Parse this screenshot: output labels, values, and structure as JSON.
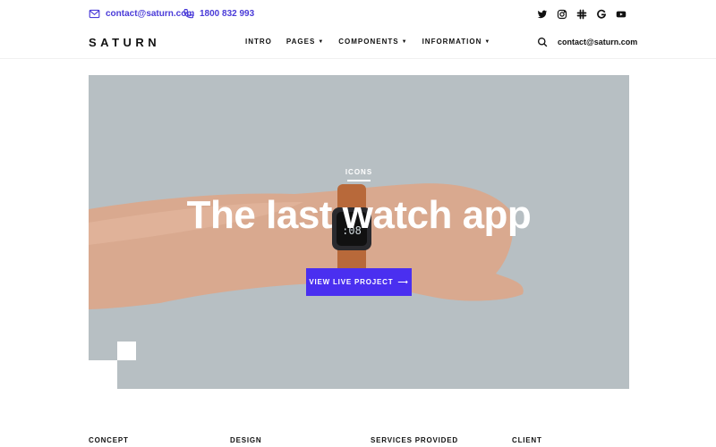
{
  "topbar": {
    "email": "contact@saturn.com",
    "phone": "1800 832 993",
    "email_icon": "mail-icon",
    "phone_icon": "phone-icon",
    "socials": [
      "twitter-icon",
      "instagram-icon",
      "slack-icon",
      "google-icon",
      "youtube-icon"
    ]
  },
  "navbar": {
    "logo": "SATURN",
    "items": [
      {
        "label": "INTRO",
        "dropdown": false
      },
      {
        "label": "PAGES",
        "dropdown": true
      },
      {
        "label": "COMPONENTS",
        "dropdown": true
      },
      {
        "label": "INFORMATION",
        "dropdown": true
      }
    ],
    "search_icon": "search-icon",
    "email": "contact@saturn.com"
  },
  "hero": {
    "tag": "ICONS",
    "title": "The last watch app",
    "button_label": "VIEW LIVE PROJECT",
    "button_arrow": "⟶"
  },
  "info": {
    "labels": [
      "CONCEPT",
      "DESIGN",
      "SERVICES PROVIDED",
      "CLIENT"
    ]
  },
  "colors": {
    "accent": "#4a2ff0",
    "link": "#4a3bd8",
    "hero_bg": "#b7bfc3"
  }
}
